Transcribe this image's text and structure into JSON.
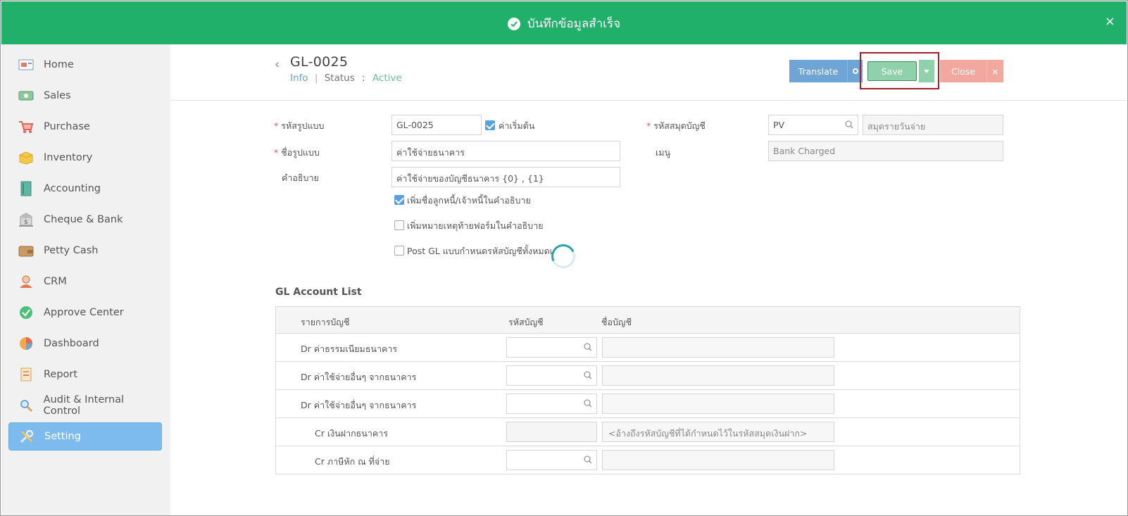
{
  "toast": {
    "message": "บันทึกข้อมูลสำเร็จ",
    "close": "×"
  },
  "sidebar": {
    "items": [
      {
        "label": "Home",
        "icon": "home-icon"
      },
      {
        "label": "Sales",
        "icon": "sales-icon"
      },
      {
        "label": "Purchase",
        "icon": "cart-icon"
      },
      {
        "label": "Inventory",
        "icon": "box-icon"
      },
      {
        "label": "Accounting",
        "icon": "book-icon"
      },
      {
        "label": "Cheque & Bank",
        "icon": "bank-icon"
      },
      {
        "label": "Petty Cash",
        "icon": "wallet-icon"
      },
      {
        "label": "CRM",
        "icon": "people-icon"
      },
      {
        "label": "Approve Center",
        "icon": "check-circle-icon"
      },
      {
        "label": "Dashboard",
        "icon": "pie-chart-icon"
      },
      {
        "label": "Report",
        "icon": "report-icon"
      },
      {
        "label": "Audit & Internal Control",
        "icon": "magnifier-icon"
      },
      {
        "label": "Setting",
        "icon": "tools-icon",
        "active": true
      }
    ]
  },
  "header": {
    "back": "‹",
    "title": "GL-0025",
    "info": "Info",
    "sep": "|",
    "status_label": "Status",
    "colon": ":",
    "status_value": "Active"
  },
  "toolbar": {
    "translate": "Translate",
    "save": "Save",
    "close": "Close",
    "close_x": "×"
  },
  "form": {
    "code_label": "รหัสรูปแบบ",
    "code_value": "GL-0025",
    "default_label": "ค่าเริ่มต้น",
    "name_label": "ชื่อรูปแบบ",
    "name_value": "ค่าใช้จ่ายธนาคาร",
    "desc_label": "คำอธิบาย",
    "desc_value": "ค่าใช้จ่ายของบัญชีธนาคาร {0} , {1}",
    "cb1_label": "เพิ่มชื่อลูกหนี้/เจ้าหนี้ในคำอธิบาย",
    "cb2_label": "เพิ่มหมายเหตุท้ายฟอร์มในคำอธิบาย",
    "cb3_label": "Post GL แบบกำหนดรหัสบัญชีทั้งหมดเ",
    "journal_label": "รหัสสมุดบัญชี",
    "journal_code": "PV",
    "journal_name": "สมุดรายวันจ่าย",
    "menu_label": "เมนู",
    "menu_value": "Bank Charged"
  },
  "gl": {
    "title": "GL Account List",
    "headers": [
      "รายการบัญชี",
      "รหัสบัญชี",
      "ชื่อบัญชี"
    ],
    "rows": [
      {
        "label": "Dr ค่าธรรมเนียมธนาคาร",
        "code": "",
        "name": ""
      },
      {
        "label": "Dr ค่าใช้จ่ายอื่นๆ จากธนาคาร",
        "code": "",
        "name": ""
      },
      {
        "label": "Dr ค่าใช้จ่ายอื่นๆ จากธนาคาร",
        "code": "",
        "name": ""
      },
      {
        "label": "Cr เงินฝากธนาคาร",
        "code": "",
        "name": "<อ้างถึงรหัสบัญชีที่ได้กำหนดไว้ในรหัสสมุดเงินฝาก>"
      },
      {
        "label": "Cr ภาษีหัก ณ ที่จ่าย",
        "code": "",
        "name": ""
      }
    ]
  },
  "colors": {
    "toast": "#20b06a",
    "translate": "#6fa4d6",
    "save": "#8fd1ab",
    "close": "#f2a89f",
    "active_nav": "#7dbbee",
    "highlight": "#a61f2b"
  }
}
